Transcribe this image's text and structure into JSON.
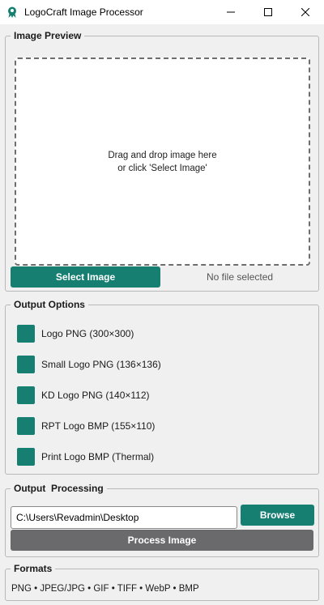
{
  "window": {
    "title": "LogoCraft Image Processor"
  },
  "preview": {
    "group_title": "Image Preview",
    "drop_line1": "Drag and drop image here",
    "drop_line2": "or click 'Select Image'",
    "select_button": "Select Image",
    "status": "No file selected"
  },
  "options": {
    "group_title": "Output Options",
    "items": [
      {
        "label": "Logo PNG (300×300)",
        "checked": true
      },
      {
        "label": "Small Logo PNG (136×136)",
        "checked": true
      },
      {
        "label": "KD Logo PNG (140×112)",
        "checked": true
      },
      {
        "label": "RPT Logo BMP (155×110)",
        "checked": true
      },
      {
        "label": "Print Logo BMP (Thermal)",
        "checked": true
      }
    ]
  },
  "processing": {
    "group_title": "Output  Processing",
    "path_value": "C:\\Users\\Revadmin\\Desktop",
    "browse_button": "Browse",
    "process_button": "Process Image"
  },
  "formats": {
    "group_title": "Formats",
    "text": "PNG • JPEG/JPG • GIF • TIFF • WebP • BMP"
  },
  "colors": {
    "accent": "#167f72",
    "process_button": "#6a6a6d",
    "background": "#f0f0f0"
  }
}
